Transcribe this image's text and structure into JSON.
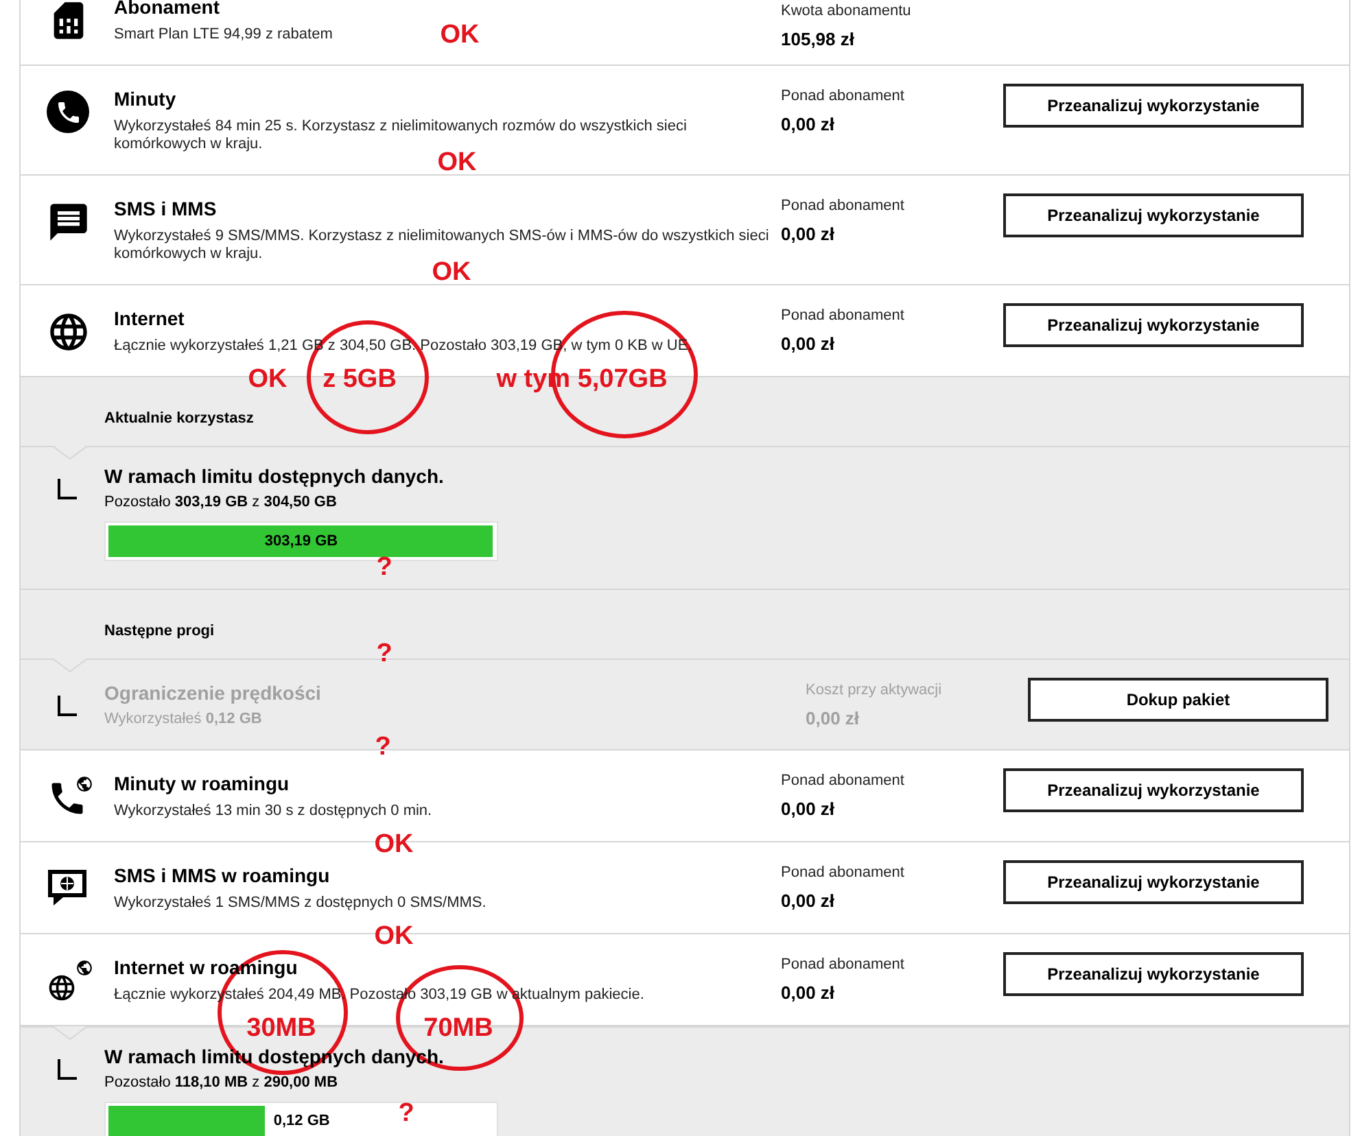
{
  "rows": [
    {
      "kind": "service",
      "title": "Abonament",
      "description": "Smart Plan LTE 94,99 z rabatem",
      "price_label": "Kwota abonamentu",
      "price": "105,98 zł"
    },
    {
      "kind": "service",
      "title": "Minuty",
      "description": "Wykorzystałeś 84 min 25 s. Korzystasz z nielimitowanych rozmów do wszystkich sieci komórkowych w kraju.",
      "price_label": "Ponad abonament",
      "price": "0,00 zł",
      "button": "Przeanalizuj wykorzystanie"
    },
    {
      "kind": "service",
      "title": "SMS i MMS",
      "description": "Wykorzystałeś 9 SMS/MMS. Korzystasz z nielimitowanych SMS-ów i MMS-ów do wszystkich sieci komórkowych w kraju.",
      "price_label": "Ponad abonament",
      "price": "0,00 zł",
      "button": "Przeanalizuj wykorzystanie"
    },
    {
      "kind": "service",
      "title": "Internet",
      "description": "Łącznie wykorzystałeś 1,21 GB z 304,50 GB. Pozostało 303,19 GB, w tym 0 KB w UE.",
      "price_label": "Ponad abonament",
      "price": "0,00 zł",
      "button": "Przeanalizuj wykorzystanie"
    },
    {
      "kind": "heading",
      "title": "Aktualnie korzystasz"
    },
    {
      "kind": "tier",
      "title": "W ramach limitu dostępnych danych.",
      "detail": "Pozostało **303,19 GB** z **304,50 GB**",
      "disabled": false,
      "bar": {
        "level": 0.996,
        "label": "303,19 GB"
      }
    },
    {
      "kind": "heading",
      "title": "Następne progi"
    },
    {
      "kind": "tier",
      "title": "Ograniczenie prędkości",
      "detail": "Wykorzystałeś **0,12 GB**",
      "disabled": true,
      "price_label": "Koszt przy aktywacji",
      "price": "0,00 zł",
      "button": "Dokup pakiet"
    },
    {
      "kind": "service",
      "title": "Minuty w roamingu",
      "description": "Wykorzystałeś 13 min 30 s z dostępnych 0 min.",
      "price_label": "Ponad abonament",
      "price": "0,00 zł",
      "button": "Przeanalizuj wykorzystanie"
    },
    {
      "kind": "service",
      "title": "SMS i MMS w roamingu",
      "description": "Wykorzystałeś 1 SMS/MMS z dostępnych 0 SMS/MMS.",
      "price_label": "Ponad abonament",
      "price": "0,00 zł",
      "button": "Przeanalizuj wykorzystanie"
    },
    {
      "kind": "service",
      "title": "Internet w roamingu",
      "description": "Łącznie wykorzystałeś 204,49 MB. Pozostało 303,19 GB w aktualnym pakiecie.",
      "price_label": "Ponad abonament",
      "price": "0,00 zł",
      "button": "Przeanalizuj wykorzystanie"
    },
    {
      "kind": "tier",
      "title": "W ramach limitu dostępnych danych.",
      "detail": "Pozostało **118,10 MB** z **290,00 MB**",
      "disabled": false,
      "bar": {
        "level": 0.407,
        "label": "0,12 GB"
      }
    }
  ],
  "annotations": [
    {
      "kind": "note",
      "text": "OK"
    },
    {
      "kind": "note",
      "text": "OK"
    },
    {
      "kind": "note",
      "text": "OK"
    },
    {
      "kind": "note",
      "text": "OK"
    },
    {
      "kind": "circled",
      "text": "z 5GB"
    },
    {
      "kind": "circled",
      "text": "w tym 5,07GB"
    },
    {
      "kind": "note",
      "text": "?"
    },
    {
      "kind": "note",
      "text": "?"
    },
    {
      "kind": "note",
      "text": "?"
    },
    {
      "kind": "note",
      "text": "OK"
    },
    {
      "kind": "note",
      "text": "OK"
    },
    {
      "kind": "circled",
      "text": "30MB"
    },
    {
      "kind": "circled",
      "text": "70MB"
    },
    {
      "kind": "note",
      "text": "?"
    }
  ]
}
